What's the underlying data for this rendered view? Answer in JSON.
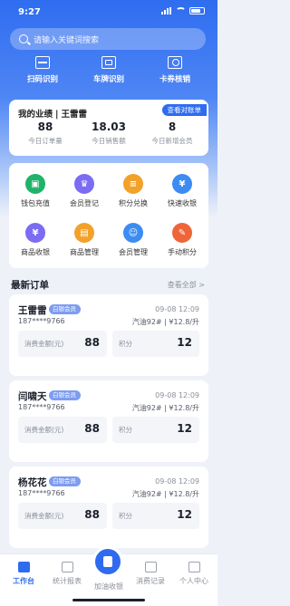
{
  "status": {
    "time": "9:27"
  },
  "search": {
    "placeholder": "请输入关键词搜索"
  },
  "quick_actions": [
    {
      "label": "扫码识别",
      "icon": "scan-icon"
    },
    {
      "label": "车牌识别",
      "icon": "license-plate-icon"
    },
    {
      "label": "卡券核销",
      "icon": "coupon-icon"
    }
  ],
  "performance": {
    "title": "我的业绩",
    "name": "王雷雷",
    "cta": "查看对账单",
    "stats": [
      {
        "value": "88",
        "label": "今日订单量"
      },
      {
        "value": "18.03",
        "label": "今日销售额"
      },
      {
        "value": "8",
        "label": "今日新增会员"
      }
    ]
  },
  "menu": [
    {
      "label": "钱包充值",
      "icon": "wallet-icon",
      "color": "#1fb36b"
    },
    {
      "label": "会员登记",
      "icon": "crown-icon",
      "color": "#7b6cf2"
    },
    {
      "label": "积分兑换",
      "icon": "coins-icon",
      "color": "#f2a12a"
    },
    {
      "label": "快速收银",
      "icon": "cashier-icon",
      "color": "#3b8cf3"
    },
    {
      "label": "商品收银",
      "icon": "goods-pay-icon",
      "color": "#7b6cf2"
    },
    {
      "label": "商品管理",
      "icon": "goods-manage-icon",
      "color": "#f2a12a"
    },
    {
      "label": "会员管理",
      "icon": "member-manage-icon",
      "color": "#3b8cf3"
    },
    {
      "label": "手动积分",
      "icon": "manual-points-icon",
      "color": "#f0643a"
    }
  ],
  "orders_section": {
    "title": "最新订单",
    "more": "查看全部 >"
  },
  "orders": [
    {
      "name": "王雷雷",
      "badge": "白银会员",
      "date": "09-08 12:09",
      "phone": "187****9766",
      "fuel": "汽油92# | ¥12.8/升",
      "amount_label": "消费金额(元)",
      "amount": "88",
      "points_label": "积分",
      "points": "12"
    },
    {
      "name": "闫啸天",
      "badge": "白银会员",
      "date": "09-08 12:09",
      "phone": "187****9766",
      "fuel": "汽油92# | ¥12.8/升",
      "amount_label": "消费金额(元)",
      "amount": "88",
      "points_label": "积分",
      "points": "12"
    },
    {
      "name": "杨花花",
      "badge": "白银会员",
      "date": "09-08 12:09",
      "phone": "187****9766",
      "fuel": "汽油92# | ¥12.8/升",
      "amount_label": "消费金额(元)",
      "amount": "88",
      "points_label": "积分",
      "points": "12"
    }
  ],
  "tabs": [
    {
      "label": "工作台",
      "active": true
    },
    {
      "label": "统计报表"
    },
    {
      "label": "加油收银"
    },
    {
      "label": "消费记录"
    },
    {
      "label": "个人中心"
    }
  ],
  "colors": {
    "accent": "#2e6bef",
    "badge": "#7d9cf2"
  }
}
